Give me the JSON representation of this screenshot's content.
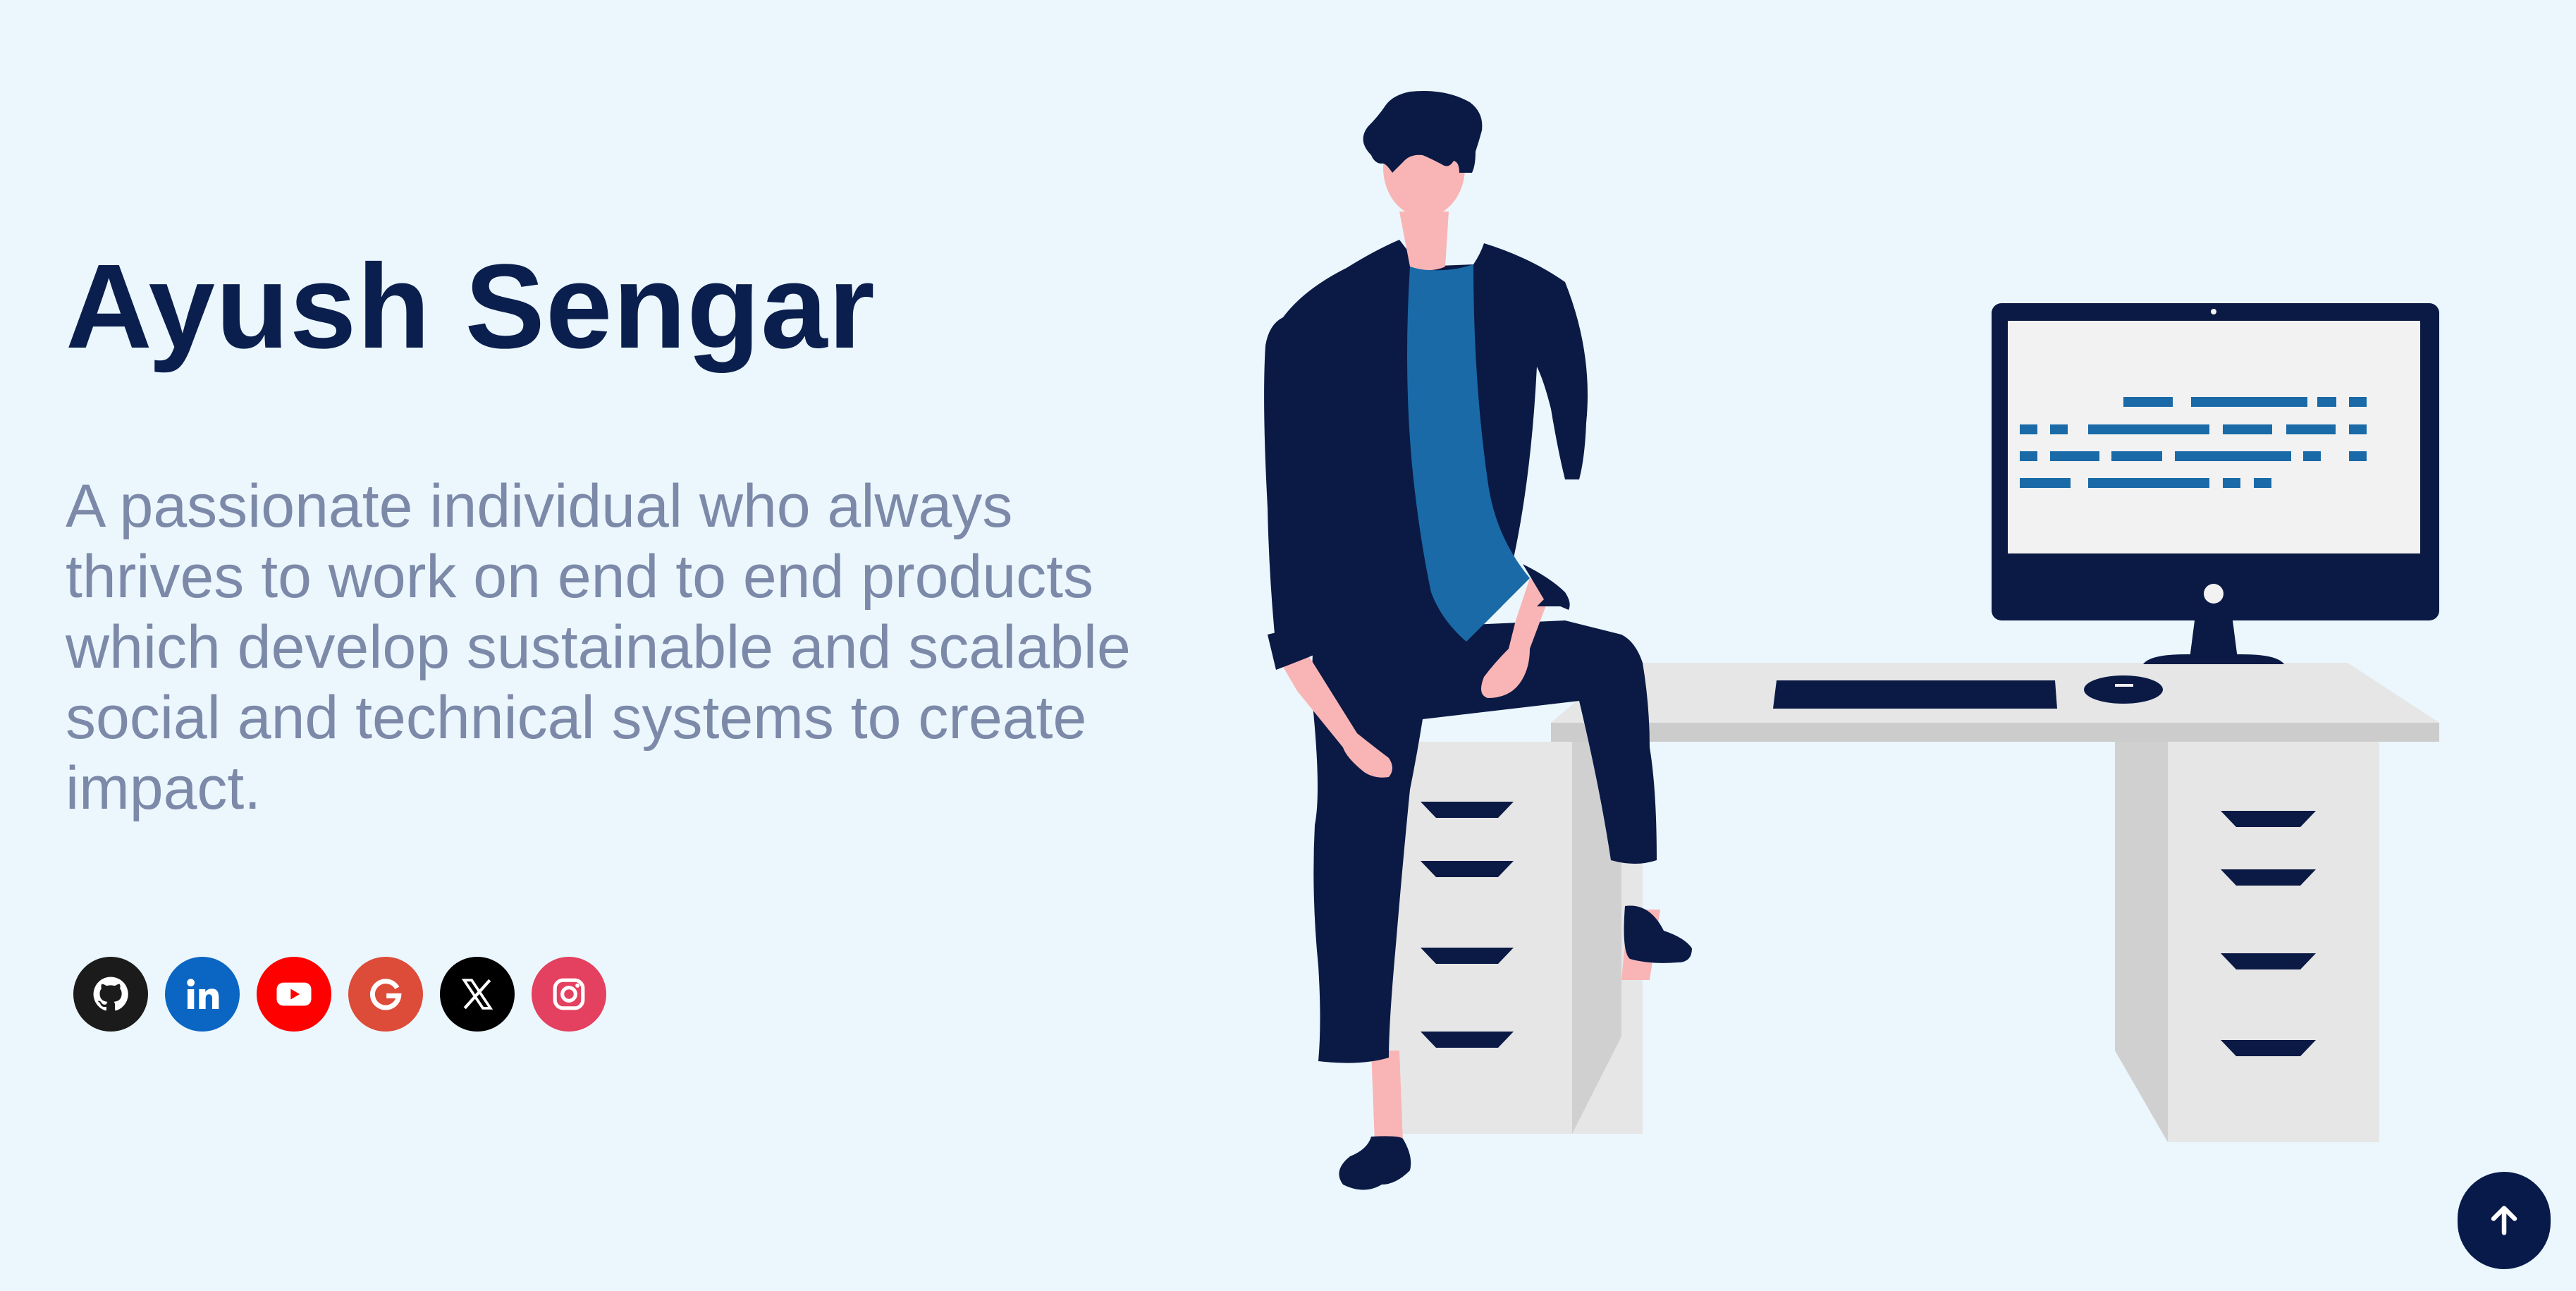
{
  "hero": {
    "name": "Ayush Sengar",
    "bio": "A passionate individual who always thrives to work on end to end products which develop sustainable and scalable social and technical systems to create impact."
  },
  "socials": [
    {
      "icon": "github-icon",
      "color": "#1b1b1b"
    },
    {
      "icon": "linkedin-icon",
      "color": "#0a66c2"
    },
    {
      "icon": "youtube-icon",
      "color": "#ff0000"
    },
    {
      "icon": "google-icon",
      "color": "#dd4b39"
    },
    {
      "icon": "x-icon",
      "color": "#000000"
    },
    {
      "icon": "instagram-icon",
      "color": "#e4405f"
    }
  ],
  "scroll_top": {
    "icon": "arrow-up-icon"
  },
  "colors": {
    "background": "#ebf7fd",
    "heading": "#0b1f4e",
    "body_text": "#7c89a8",
    "navy": "#071a4a",
    "accent_blue": "#1a6aa8"
  }
}
